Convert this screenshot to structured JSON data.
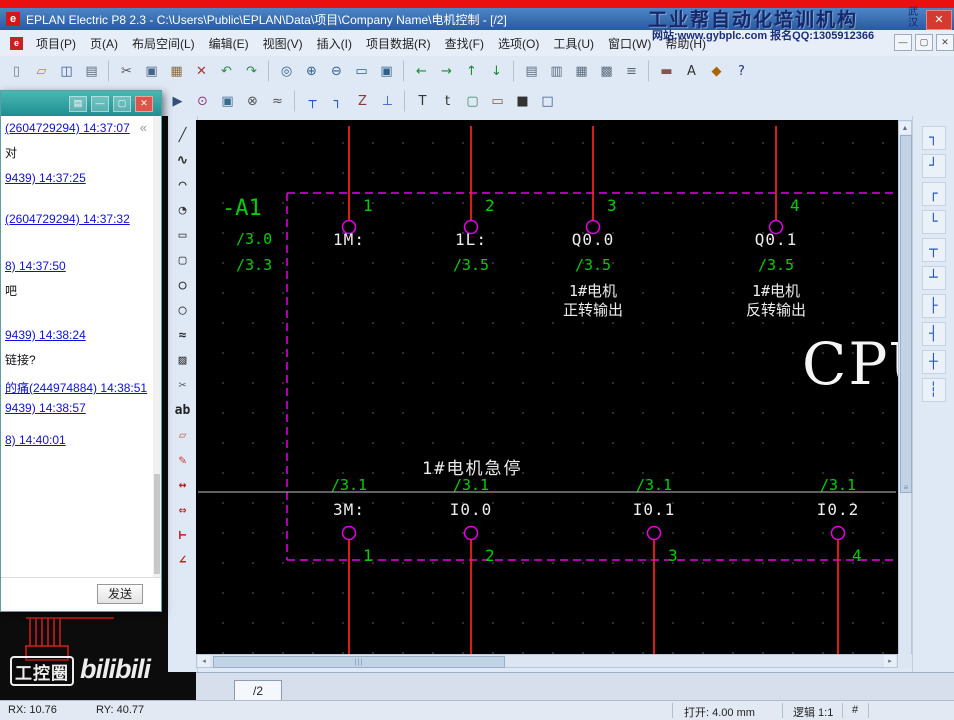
{
  "titlebar": {
    "title": "EPLAN Electric P8 2.3 - C:\\Users\\Public\\EPLAN\\Data\\项目\\Company Name\\电机控制 - [/2]",
    "app_icon_letter": "e",
    "close_glyph": "✕"
  },
  "brand": {
    "line1": "工业帮自动化培训机构",
    "city": "武汉",
    "line2": "网站:www.gybplc.com  报名QQ:1305912366"
  },
  "menubar": {
    "doc_icon_letter": "e",
    "items": [
      "项目(P)",
      "页(A)",
      "布局空间(L)",
      "编辑(E)",
      "视图(V)",
      "插入(I)",
      "项目数据(R)",
      "查找(F)",
      "选项(O)",
      "工具(U)",
      "窗口(W)",
      "帮助(H)"
    ],
    "close_glyphs": [
      "—",
      "▢",
      "✕"
    ]
  },
  "toolbar_main": {
    "icons": [
      {
        "name": "new-page-icon",
        "glyph": "▯",
        "color": "#6b7f99"
      },
      {
        "name": "open-project-icon",
        "glyph": "▱",
        "color": "#b08a3a"
      },
      {
        "name": "save-icon",
        "glyph": "◫",
        "color": "#35589a"
      },
      {
        "name": "print-icon",
        "glyph": "▤",
        "color": "#5a6b7d"
      },
      {
        "name": "separator",
        "glyph": "",
        "cls": "sep"
      },
      {
        "name": "cut-icon",
        "glyph": "✂",
        "color": "#555555"
      },
      {
        "name": "copy-icon",
        "glyph": "▣",
        "color": "#456485"
      },
      {
        "name": "paste-icon",
        "glyph": "▦",
        "color": "#8a6a3a"
      },
      {
        "name": "delete-icon",
        "glyph": "✕",
        "color": "#aa3333"
      },
      {
        "name": "undo-icon",
        "glyph": "↶",
        "color": "#2a8a4a"
      },
      {
        "name": "redo-icon",
        "glyph": "↷",
        "color": "#2a8a4a"
      },
      {
        "name": "separator",
        "glyph": "",
        "cls": "sep"
      },
      {
        "name": "find-icon",
        "glyph": "◎",
        "color": "#33608a"
      },
      {
        "name": "zoom-in-icon",
        "glyph": "⊕",
        "color": "#33608a"
      },
      {
        "name": "zoom-out-icon",
        "glyph": "⊖",
        "color": "#33608a"
      },
      {
        "name": "zoom-window-icon",
        "glyph": "▭",
        "color": "#33608a"
      },
      {
        "name": "zoom-fit-icon",
        "glyph": "▣",
        "color": "#33608a"
      },
      {
        "name": "separator",
        "glyph": "",
        "cls": "sep"
      },
      {
        "name": "previous-page-icon",
        "glyph": "←",
        "color": "#1b8a33"
      },
      {
        "name": "next-page-icon",
        "glyph": "→",
        "color": "#1b8a33"
      },
      {
        "name": "page-up-icon",
        "glyph": "↑",
        "color": "#1b8a33"
      },
      {
        "name": "page-down-icon",
        "glyph": "↓",
        "color": "#1b8a33"
      },
      {
        "name": "separator",
        "glyph": "",
        "cls": "sep"
      },
      {
        "name": "grid-small-icon",
        "glyph": "▤",
        "color": "#5a6b7d"
      },
      {
        "name": "grid-medium-icon",
        "glyph": "▥",
        "color": "#5a6b7d"
      },
      {
        "name": "grid-large-icon",
        "glyph": "▦",
        "color": "#5a6b7d"
      },
      {
        "name": "grid-extra-icon",
        "glyph": "▩",
        "color": "#5a6b7d"
      },
      {
        "name": "snap-grid-icon",
        "glyph": "≡",
        "color": "#5a6b7d"
      },
      {
        "name": "separator",
        "glyph": "",
        "cls": "sep"
      },
      {
        "name": "ruler-icon",
        "glyph": "▬",
        "color": "#845555"
      },
      {
        "name": "text-size-icon",
        "glyph": "A",
        "color": "#333333"
      },
      {
        "name": "lock-icon",
        "glyph": "◆",
        "color": "#aa6600"
      },
      {
        "name": "help-icon",
        "glyph": "?",
        "color": "#223388"
      }
    ]
  },
  "toolbar_edit": {
    "icons": [
      {
        "name": "select-tool-icon",
        "glyph": "▶",
        "color": "#33507a"
      },
      {
        "name": "insert-symbol-icon",
        "glyph": "⊙",
        "color": "#8a3a6a"
      },
      {
        "name": "insert-device-icon",
        "glyph": "▣",
        "color": "#3a6a8a"
      },
      {
        "name": "insert-terminal-icon",
        "glyph": "⊗",
        "color": "#555555"
      },
      {
        "name": "insert-cable-icon",
        "glyph": "≈",
        "color": "#555555"
      },
      {
        "name": "separator",
        "glyph": "",
        "cls": "sep"
      },
      {
        "name": "t-node-icon",
        "glyph": "┬",
        "color": "#2255cc"
      },
      {
        "name": "corner-icon",
        "glyph": "┐",
        "color": "#2255cc"
      },
      {
        "name": "interruption-point-icon",
        "glyph": "Z",
        "color": "#8a3a3a"
      },
      {
        "name": "potential-icon",
        "glyph": "⊥",
        "color": "#2255cc"
      },
      {
        "name": "separator",
        "glyph": "",
        "cls": "sep"
      },
      {
        "name": "insert-text-icon",
        "glyph": "T",
        "color": "#333333"
      },
      {
        "name": "path-function-text-icon",
        "glyph": "t",
        "color": "#333333"
      },
      {
        "name": "macro-box-icon",
        "glyph": "▢",
        "color": "#3a8a5a"
      },
      {
        "name": "plc-box-icon",
        "glyph": "▭",
        "color": "#8a5a3a"
      },
      {
        "name": "black-box-icon",
        "glyph": "■",
        "color": "#333333"
      },
      {
        "name": "structure-box-icon",
        "glyph": "□",
        "color": "#3a5a8a"
      }
    ]
  },
  "left_palette": {
    "icons": [
      {
        "name": "line-tool-icon",
        "glyph": "╱",
        "color": "#333333"
      },
      {
        "name": "polyline-tool-icon",
        "glyph": "∿",
        "color": "#333333"
      },
      {
        "name": "arc-tool-icon",
        "glyph": "◠",
        "color": "#333333"
      },
      {
        "name": "sector-tool-icon",
        "glyph": "◔",
        "color": "#333333"
      },
      {
        "name": "rectangle-tool-icon",
        "glyph": "▭",
        "color": "#333333"
      },
      {
        "name": "rounded-rect-tool-icon",
        "glyph": "▢",
        "color": "#333333"
      },
      {
        "name": "circle-tool-icon",
        "glyph": "○",
        "color": "#333333"
      },
      {
        "name": "ellipse-tool-icon",
        "glyph": "◯",
        "color": "#333333"
      },
      {
        "name": "spline-tool-icon",
        "glyph": "≈",
        "color": "#333333"
      },
      {
        "name": "hatch-tool-icon",
        "glyph": "▨",
        "color": "#333333"
      },
      {
        "name": "trim-tool-icon",
        "glyph": "✂",
        "color": "#555555"
      },
      {
        "name": "text-tool-icon",
        "glyph": "ab",
        "color": "#222222"
      },
      {
        "name": "eraser-tool-icon",
        "glyph": "▱",
        "color": "#cc6666"
      },
      {
        "name": "brush-tool-icon",
        "glyph": "✎",
        "color": "#cc3333"
      },
      {
        "name": "dimension-linear-icon",
        "glyph": "↔",
        "color": "#bb2222"
      },
      {
        "name": "dimension-chain-icon",
        "glyph": "⇔",
        "color": "#bb2222"
      },
      {
        "name": "dimension-baseline-icon",
        "glyph": "⊢",
        "color": "#bb2222"
      },
      {
        "name": "angle-tool-icon",
        "glyph": "∠",
        "color": "#bb2222"
      }
    ]
  },
  "right_palette": {
    "icons": [
      {
        "name": "corner-down-left-icon",
        "glyph": "┐",
        "color": "#2255cc"
      },
      {
        "name": "corner-up-left-icon",
        "glyph": "┘",
        "color": "#2255cc"
      },
      {
        "name": "corner-down-right-icon",
        "glyph": "┌",
        "color": "#2255cc"
      },
      {
        "name": "corner-up-right-icon",
        "glyph": "└",
        "color": "#2255cc"
      },
      {
        "name": "t-node-down-icon",
        "glyph": "┬",
        "color": "#2255cc"
      },
      {
        "name": "t-node-up-icon",
        "glyph": "┴",
        "color": "#2255cc"
      },
      {
        "name": "t-node-right-icon",
        "glyph": "├",
        "color": "#2255cc"
      },
      {
        "name": "t-node-left-icon",
        "glyph": "┤",
        "color": "#2255cc"
      },
      {
        "name": "cross-connection-icon",
        "glyph": "┼",
        "color": "#2255cc"
      },
      {
        "name": "break-point-icon",
        "glyph": "┆",
        "color": "#2255cc"
      }
    ]
  },
  "chat": {
    "buttons": {
      "settings": "▤",
      "minimize": "—",
      "maximize": "▢",
      "close": "✕"
    },
    "collapse_glyph": "«",
    "messages": [
      {
        "text": "(2604729294)  14:37:07",
        "cls": "link"
      },
      {
        "text": "对",
        "cls": "plain"
      },
      {
        "text": "9439)  14:37:25",
        "cls": "link"
      },
      {
        "text": "(2604729294)  14:37:32",
        "cls": "link"
      },
      {
        "text": "8)  14:37:50",
        "cls": "link"
      },
      {
        "text": "吧",
        "cls": "plain"
      },
      {
        "text": "9439)  14:38:24",
        "cls": "link"
      },
      {
        "text": "链接?",
        "cls": "plain"
      },
      {
        "text": "的痛(244974884)  14:38:51",
        "cls": "link"
      },
      {
        "text": "9439)  14:38:57",
        "cls": "link"
      },
      {
        "text": "8)  14:40:01",
        "cls": "link"
      }
    ],
    "send_label": "发送"
  },
  "schematic": {
    "device_tag": "-A1",
    "cross_refs_left": [
      "/3.0",
      "/3.3"
    ],
    "top_terminals": [
      {
        "num": "1",
        "label": "1M:",
        "ref": "",
        "desc1": "",
        "desc2": ""
      },
      {
        "num": "2",
        "label": "1L:",
        "ref": "/3.5",
        "desc1": "",
        "desc2": ""
      },
      {
        "num": "3",
        "label": "Q0.0",
        "ref": "/3.5",
        "desc1": "1#电机",
        "desc2": "正转输出"
      },
      {
        "num": "4",
        "label": "Q0.1",
        "ref": "/3.5",
        "desc1": "1#电机",
        "desc2": "反转输出"
      }
    ],
    "cpu_label": "CPU",
    "estop_label": "1#电机急停",
    "bottom_terminals": [
      {
        "ref": "/3.1",
        "label": "3M:",
        "num": "1"
      },
      {
        "ref": "/3.1",
        "label": "I0.0",
        "num": "2"
      },
      {
        "ref": "/3.1",
        "label": "I0.1",
        "num": "3"
      },
      {
        "ref": "/3.1",
        "label": "I0.2",
        "num": "4"
      }
    ],
    "colors": {
      "wire": "#ff2020",
      "symbol": "#e600e6",
      "text_green": "#00cf00",
      "text_white": "#ececec"
    }
  },
  "scrollbars": {
    "up": "▲",
    "down": "▼",
    "left": "◂",
    "right": "▸",
    "h_grip": "|||",
    "v_grip": "≡"
  },
  "tabbar": {
    "active_tab": "/2"
  },
  "statusbar": {
    "rx": "RX: 10.76",
    "ry": "RY: 40.77",
    "grid": "打开: 4.00 mm",
    "logic": "逻辑 1:1",
    "hash": "#"
  },
  "watermarks": {
    "left_badge": "工控圈",
    "video_logo": "bilibili"
  }
}
